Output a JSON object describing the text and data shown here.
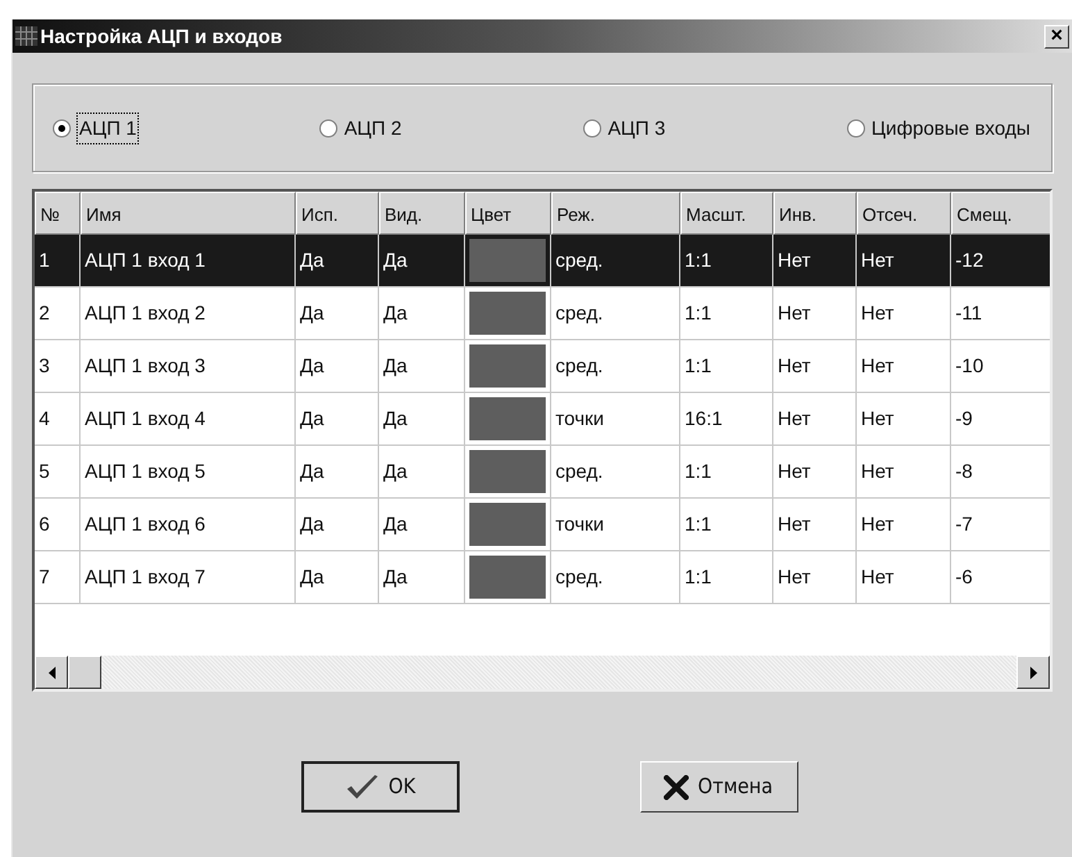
{
  "window": {
    "title": "Настройка АЦП и входов",
    "close": "×"
  },
  "sources": [
    {
      "label": "АЦП 1",
      "selected": true
    },
    {
      "label": "АЦП 2",
      "selected": false
    },
    {
      "label": "АЦП 3",
      "selected": false
    },
    {
      "label": "Цифровые входы",
      "selected": false
    }
  ],
  "table": {
    "columns": [
      {
        "label": "№",
        "kind": "text"
      },
      {
        "label": "Имя",
        "kind": "text"
      },
      {
        "label": "Исп.",
        "kind": "text"
      },
      {
        "label": "Вид.",
        "kind": "text"
      },
      {
        "label": "Цвет",
        "kind": "color"
      },
      {
        "label": "Реж.",
        "kind": "text"
      },
      {
        "label": "Масшт.",
        "kind": "text"
      },
      {
        "label": "Инв.",
        "kind": "text"
      },
      {
        "label": "Отсеч.",
        "kind": "text"
      },
      {
        "label": "Смещ.",
        "kind": "text"
      }
    ],
    "rows": [
      {
        "selected": true,
        "color": "#5e5e5e",
        "cells": [
          "1",
          "АЦП 1 вход 1",
          "Да",
          "Да",
          "",
          "сред.",
          "1:1",
          "Нет",
          "Нет",
          "-12"
        ]
      },
      {
        "selected": false,
        "color": "#5e5e5e",
        "cells": [
          "2",
          "АЦП 1 вход 2",
          "Да",
          "Да",
          "",
          "сред.",
          "1:1",
          "Нет",
          "Нет",
          "-11"
        ]
      },
      {
        "selected": false,
        "color": "#5e5e5e",
        "cells": [
          "3",
          "АЦП 1 вход 3",
          "Да",
          "Да",
          "",
          "сред.",
          "1:1",
          "Нет",
          "Нет",
          "-10"
        ]
      },
      {
        "selected": false,
        "color": "#5e5e5e",
        "cells": [
          "4",
          "АЦП 1 вход 4",
          "Да",
          "Да",
          "",
          "точки",
          "16:1",
          "Нет",
          "Нет",
          "-9"
        ]
      },
      {
        "selected": false,
        "color": "#5e5e5e",
        "cells": [
          "5",
          "АЦП 1 вход 5",
          "Да",
          "Да",
          "",
          "сред.",
          "1:1",
          "Нет",
          "Нет",
          "-8"
        ]
      },
      {
        "selected": false,
        "color": "#5e5e5e",
        "cells": [
          "6",
          "АЦП 1 вход 6",
          "Да",
          "Да",
          "",
          "точки",
          "1:1",
          "Нет",
          "Нет",
          "-7"
        ]
      },
      {
        "selected": false,
        "color": "#5e5e5e",
        "cells": [
          "7",
          "АЦП 1 вход 7",
          "Да",
          "Да",
          "",
          "сред.",
          "1:1",
          "Нет",
          "Нет",
          "-6"
        ]
      }
    ]
  },
  "buttons": [
    {
      "label": "OK",
      "kind": "ok"
    },
    {
      "label": "Отмена",
      "kind": "cancel"
    }
  ]
}
